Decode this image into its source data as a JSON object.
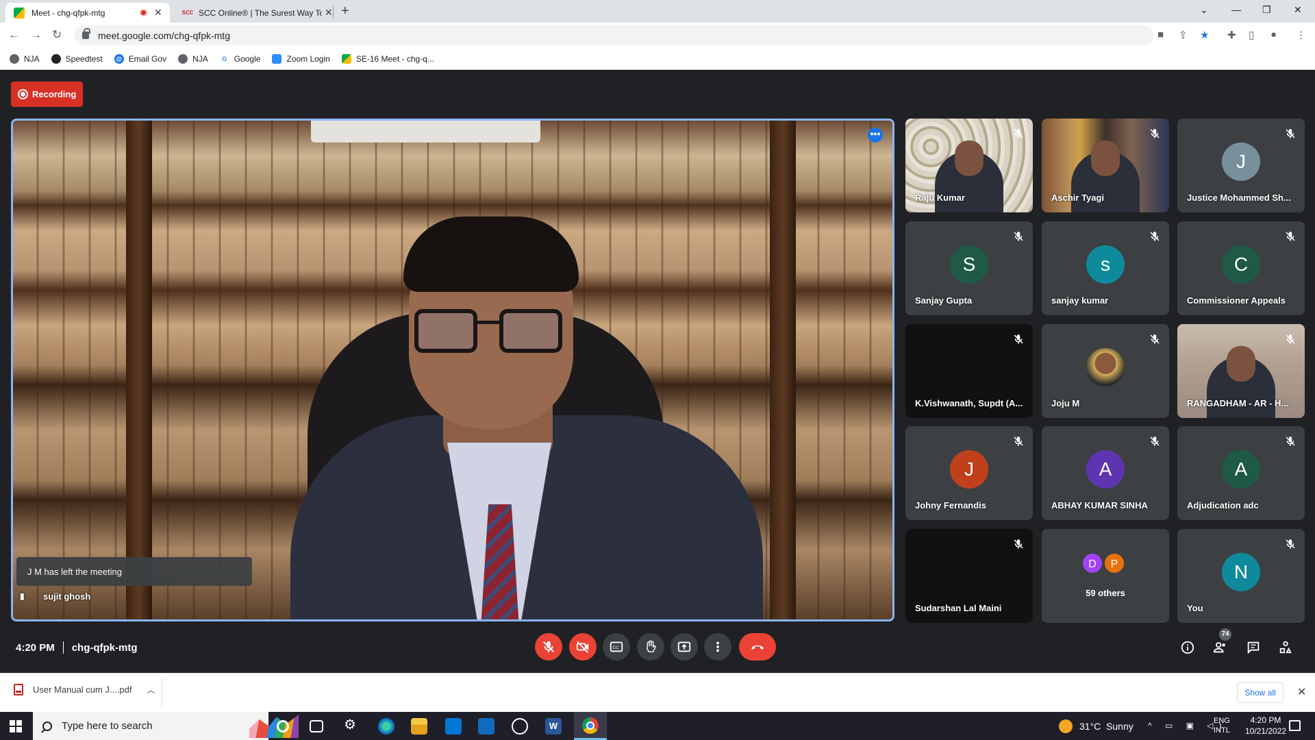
{
  "browser": {
    "tabs": [
      {
        "title": "Meet - chg-qfpk-mtg",
        "active": true,
        "recording": true
      },
      {
        "title": "SCC Online® | The Surest Way To",
        "favicon_text": "SCC"
      }
    ],
    "url": "meet.google.com/chg-qfpk-mtg",
    "bookmarks": [
      "NJA",
      "Speedtest",
      "Email Gov",
      "NJA",
      "Google",
      "Zoom Login",
      "SE-16 Meet - chg-q..."
    ]
  },
  "meet": {
    "recording_label": "Recording",
    "toast": "J M has left the meeting",
    "main_speaker": "sujit ghosh",
    "participants": [
      {
        "name": "Raju Kumar",
        "type": "video"
      },
      {
        "name": "Aschir Tyagi",
        "type": "video"
      },
      {
        "name": "Justice Mohammed Sh...",
        "initial": "J",
        "color": "#78909c"
      },
      {
        "name": "Sanjay Gupta",
        "initial": "S",
        "color": "#1e5a46"
      },
      {
        "name": "sanjay kumar",
        "initial": "s",
        "color": "#0f8a9d"
      },
      {
        "name": "Commissioner Appeals",
        "initial": "C",
        "color": "#1e5a46"
      },
      {
        "name": "K.Vishwanath, Supdt (A...",
        "type": "dark"
      },
      {
        "name": "Joju M",
        "type": "photo"
      },
      {
        "name": "RANGADHAM - AR - H...",
        "type": "video"
      },
      {
        "name": "Johny Fernandis",
        "initial": "J",
        "color": "#c1401c"
      },
      {
        "name": "ABHAY KUMAR SINHA",
        "initial": "A",
        "color": "#5e35b1"
      },
      {
        "name": "Adjudication adc",
        "initial": "A",
        "color": "#1e5a46"
      },
      {
        "name": "Sudarshan Lal Maini",
        "type": "dark"
      },
      {
        "name": "59 others",
        "others": [
          "D",
          "P"
        ],
        "others_colors": [
          "#a142f4",
          "#e8710a"
        ]
      },
      {
        "name": "You",
        "initial": "N",
        "color": "#0f8a9d"
      }
    ],
    "time": "4:20 PM",
    "meeting_code": "chg-qfpk-mtg",
    "people_count": "74"
  },
  "downloads": {
    "file": "User Manual cum J....pdf",
    "show_all": "Show all"
  },
  "taskbar": {
    "search_placeholder": "Type here to search",
    "weather": "31°C  Sunny",
    "lang_line1": "ENG",
    "lang_line2": "INTL",
    "time": "4:20 PM",
    "date": "10/21/2022"
  }
}
